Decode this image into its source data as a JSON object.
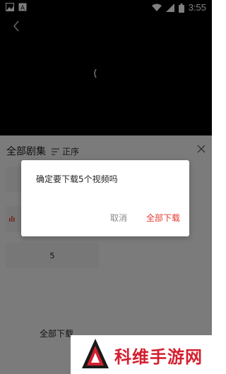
{
  "status_bar": {
    "time": "3:55",
    "icons": [
      "image-icon",
      "text-a-icon",
      "wifi-icon",
      "signal-icon",
      "battery-icon"
    ]
  },
  "player": {
    "back_icon": "chevron-left-icon",
    "loading_icon": "spinner-icon"
  },
  "episode_sheet": {
    "title": "全部剧集",
    "sort_label": "正序",
    "sort_icon": "sort-lines-icon",
    "close_icon": "close-icon",
    "visible_episode_label": "5",
    "download_all_label": "全部下载"
  },
  "dialog": {
    "message": "确定要下载5个视频吗",
    "cancel_label": "取消",
    "confirm_label": "全部下载",
    "confirm_color": "#e63a2e"
  },
  "watermark": {
    "text": "科维手游网"
  }
}
